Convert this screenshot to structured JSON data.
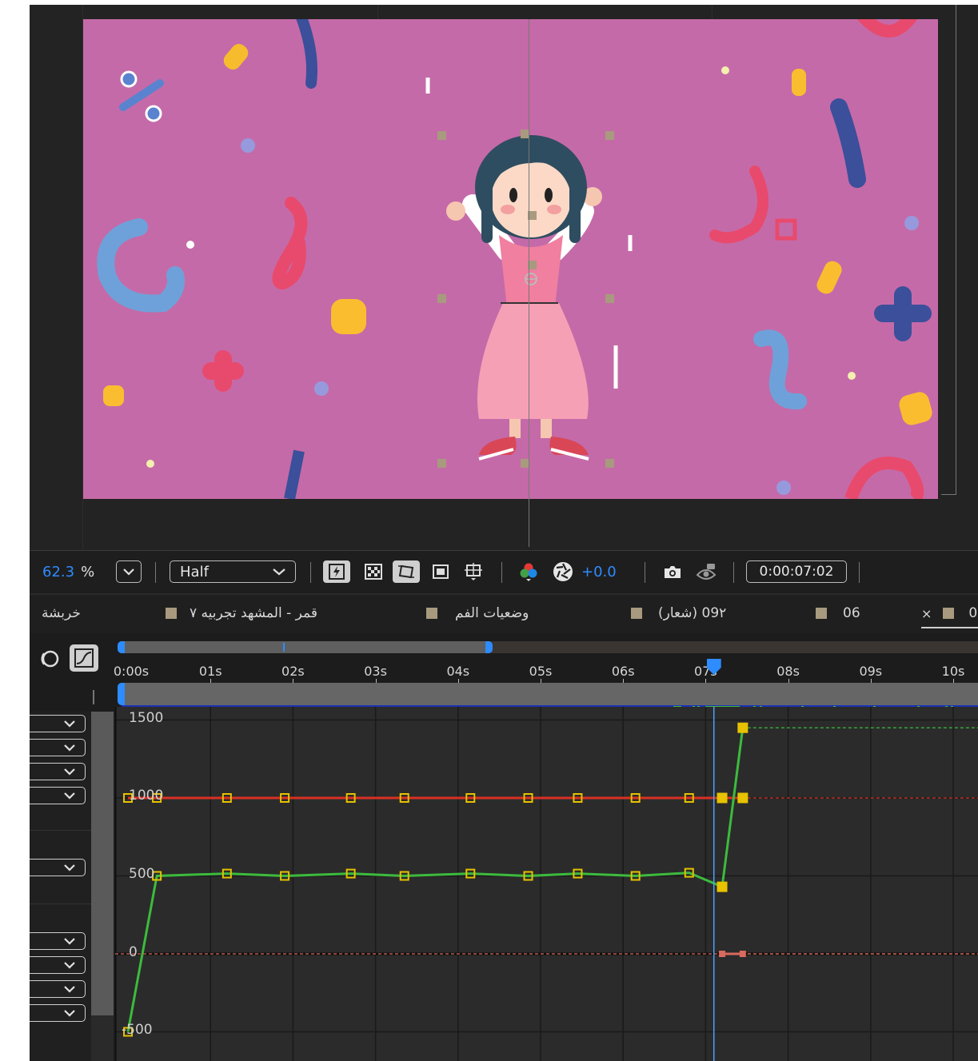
{
  "viewer": {
    "zoom_value": "62.3",
    "zoom_unit": "%",
    "resolution": "Half",
    "exposure": "+0.0",
    "timecode": "0:00:07:02",
    "accent_color": "#2d8cff"
  },
  "tabs": [
    {
      "label": "خربشة"
    },
    {
      "label": "قمر - المشهد تجربيه ٧"
    },
    {
      "label": "وضعيات الفم"
    },
    {
      "label": "(شعار) ٢‏09"
    },
    {
      "label": "06"
    },
    {
      "label": "0",
      "active": true,
      "close": "×"
    }
  ],
  "timeline": {
    "start_label": "0:00s",
    "ruler_labels": [
      "01s",
      "02s",
      "03s",
      "04s",
      "05s",
      "06s",
      "07s",
      "08s",
      "09s",
      "10s"
    ],
    "graph_y_labels": [
      "1500",
      "1000",
      "500",
      "0",
      "-500"
    ],
    "current_time_seconds": 7.1
  },
  "graph": {
    "x_unit": "s",
    "green_curve": [
      [
        0,
        -500
      ],
      [
        0.35,
        500
      ],
      [
        1.2,
        515
      ],
      [
        1.9,
        500
      ],
      [
        2.7,
        515
      ],
      [
        3.35,
        500
      ],
      [
        4.15,
        515
      ],
      [
        4.85,
        500
      ],
      [
        5.45,
        515
      ],
      [
        6.15,
        500
      ],
      [
        6.8,
        520
      ],
      [
        7.2,
        430
      ],
      [
        7.45,
        1450
      ]
    ],
    "red_curve": [
      [
        0,
        1000
      ],
      [
        0.35,
        1000
      ],
      [
        1.2,
        1000
      ],
      [
        1.9,
        1000
      ],
      [
        2.7,
        1000
      ],
      [
        3.35,
        1000
      ],
      [
        4.15,
        1000
      ],
      [
        4.85,
        1000
      ],
      [
        5.45,
        1000
      ],
      [
        6.15,
        1000
      ],
      [
        6.8,
        1000
      ],
      [
        7.2,
        1000
      ],
      [
        7.45,
        1000
      ]
    ],
    "salmon_curve": [
      [
        7.2,
        0
      ],
      [
        7.45,
        0
      ]
    ],
    "green_color": "#3dbb3d",
    "red_color": "#d93025",
    "salmon_color": "#d96a5e",
    "keyframe_color": "#e6c200"
  }
}
